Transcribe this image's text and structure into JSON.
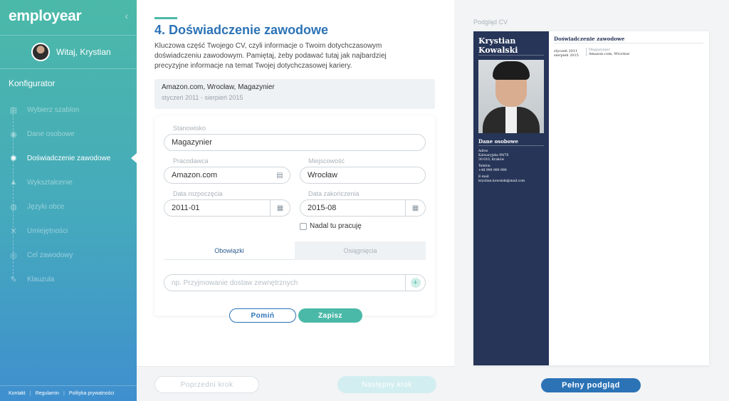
{
  "brand": "employear",
  "sidebar": {
    "greeting": "Witaj, Krystian",
    "section_title": "Konfigurator",
    "steps": [
      {
        "label": "Wybierz szablon",
        "icon": "template-icon"
      },
      {
        "label": "Dane osobowe",
        "icon": "person-icon"
      },
      {
        "label": "Doświadczenie zawodowe",
        "icon": "badge-icon",
        "active": true
      },
      {
        "label": "Wykształcenie",
        "icon": "education-icon"
      },
      {
        "label": "Języki obce",
        "icon": "globe-icon"
      },
      {
        "label": "Umiejętności",
        "icon": "skills-icon"
      },
      {
        "label": "Cel zawodowy",
        "icon": "target-icon"
      },
      {
        "label": "Klauzula",
        "icon": "pen-icon"
      }
    ],
    "footer": [
      "Kontakt",
      "Regulamin",
      "Polityka prywatności"
    ]
  },
  "main": {
    "title": "4. Doświadczenie zawodowe",
    "intro": "Kluczowa część Twojego CV, czyli informacje o Twoim dotychczasowym doświadczeniu zawodowym. Pamiętaj, żeby podawać tutaj jak najbardziej precyzyjne informacje na temat Twojej dotychczasowej kariery.",
    "summary": {
      "line1": "Amazon.com, Wrocław, Magazynier",
      "line2": "styczeń 2011 - sierpień 2015"
    },
    "form": {
      "position_label": "Stanowisko",
      "position_value": "Magazynier",
      "employer_label": "Pracodawca",
      "employer_value": "Amazon.com",
      "city_label": "Miejscowość",
      "city_value": "Wrocław",
      "start_label": "Data rozpoczęcia",
      "start_value": "2011-01",
      "end_label": "Data zakończenia",
      "end_value": "2015-08",
      "still_working": "Nadal tu pracuję",
      "tab_duties": "Obowiązki",
      "tab_achievements": "Osiągnięcia",
      "duty_placeholder": "np. Przyjmowanie dostaw zewnętrznych"
    },
    "skip_label": "Pomiń",
    "save_label": "Zapisz",
    "prev_label": "Poprzedni krok",
    "next_label": "Następny krok"
  },
  "preview": {
    "label": "Podgląd CV",
    "name_first": "Krystian",
    "name_last": "Kowalski",
    "section_personal": "Dane osobowe",
    "address_label": "Adres",
    "address_line1": "Kalwaryjska 99/78",
    "address_line2": "30-010, Kraków",
    "phone_label": "Telefon",
    "phone_value": "+48 999 999 999",
    "email_label": "E-mail",
    "email_value": "krystian.kowalski@mail.com",
    "section_experience": "Doświadczenie zawodowe",
    "job_start": "styczeń 2011",
    "job_end": "sierpień 2015",
    "job_position": "Magazynier",
    "job_company": "Amazon.com, Wrocław",
    "full_preview_label": "Pełny podgląd"
  }
}
